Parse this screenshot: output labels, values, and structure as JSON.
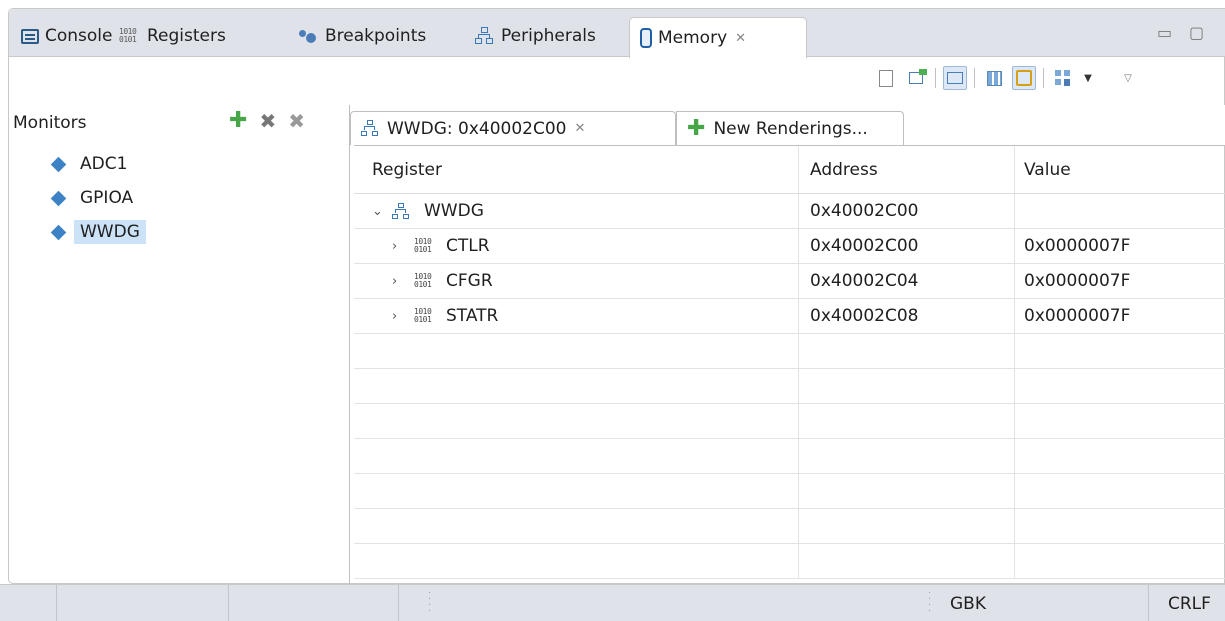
{
  "view_tabs": [
    {
      "label": "Console",
      "icon": "console-icon"
    },
    {
      "label": "Registers",
      "icon": "registers-icon"
    },
    {
      "label": "Breakpoints",
      "icon": "breakpoints-icon"
    },
    {
      "label": "Peripherals",
      "icon": "peripherals-icon"
    },
    {
      "label": "Memory",
      "icon": "memory-icon",
      "active": true,
      "close": "✕"
    }
  ],
  "window_controls": {
    "minimize": "▭",
    "maximize": "▢"
  },
  "monitors": {
    "title": "Monitors",
    "items": [
      {
        "label": "ADC1"
      },
      {
        "label": "GPIOA"
      },
      {
        "label": "WWDG",
        "selected": true
      }
    ]
  },
  "rendering_tabs": {
    "active": {
      "label": "WWDG: 0x40002C00",
      "close": "✕"
    },
    "new": {
      "label": "New Renderings..."
    }
  },
  "table": {
    "headers": {
      "register": "Register",
      "address": "Address",
      "value": "Value"
    },
    "group": {
      "name": "WWDG",
      "address": "0x40002C00",
      "value": "",
      "expanded_glyph": "⌄"
    },
    "rows": [
      {
        "name": "CTLR",
        "address": "0x40002C00",
        "value": "0x0000007F"
      },
      {
        "name": "CFGR",
        "address": "0x40002C04",
        "value": "0x0000007F"
      },
      {
        "name": "STATR",
        "address": "0x40002C08",
        "value": "0x0000007F"
      }
    ],
    "collapsed_glyph": "›"
  },
  "statusbar": {
    "encoding": "GBK",
    "line_ending": "CRLF"
  },
  "colors": {
    "selection": "#cce3f7",
    "accent_blue": "#3d82c4",
    "add_green": "#46a546"
  }
}
